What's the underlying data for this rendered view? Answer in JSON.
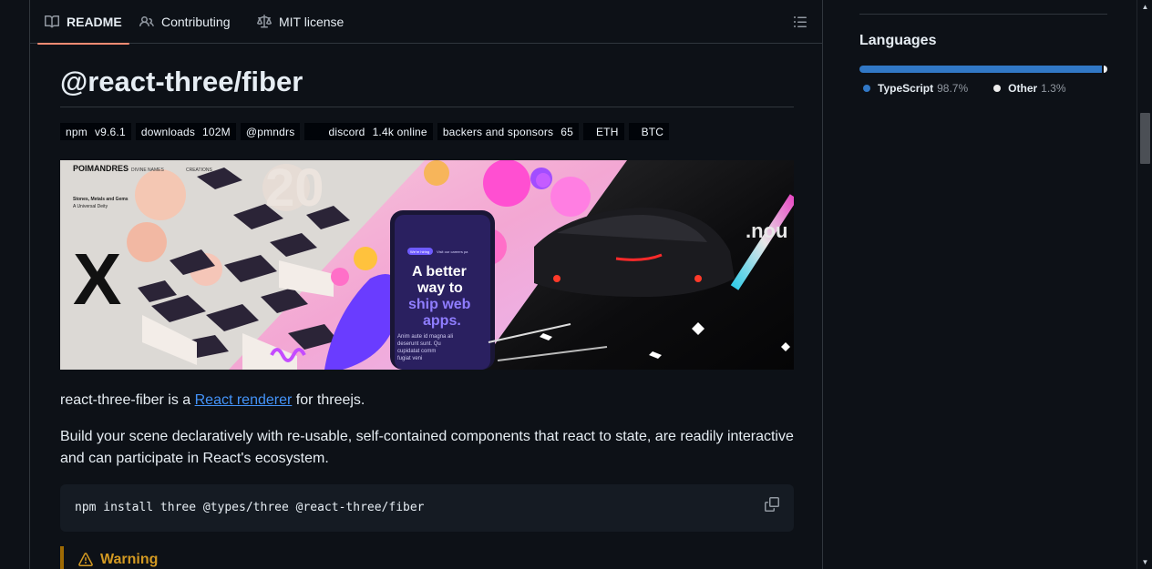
{
  "tabs": [
    {
      "label": "README",
      "icon": "book-icon",
      "active": true
    },
    {
      "label": "Contributing",
      "icon": "people-icon",
      "active": false
    },
    {
      "label": "MIT license",
      "icon": "law-icon",
      "active": false
    }
  ],
  "readme": {
    "title": "@react-three/fiber",
    "badges": [
      {
        "label": "npm",
        "value": "v9.6.1"
      },
      {
        "label": "downloads",
        "value": "102M"
      },
      {
        "label": "@pmndrs",
        "value": ""
      },
      {
        "label": "discord",
        "value": "1.4k online"
      },
      {
        "label": "backers and sponsors",
        "value": "65"
      },
      {
        "label": "ETH",
        "value": ""
      },
      {
        "label": "BTC",
        "value": ""
      }
    ],
    "hero": {
      "brand": "POIMANDRES",
      "nav1": "DIVINE NAMES",
      "nav2": "CREATIONS",
      "sub1": "Stones, Metals and Gems",
      "sub2": "A Universal Deity",
      "phone_l1": "A better",
      "phone_l2": "way to",
      "phone_l3": "ship web",
      "phone_l4": "apps.",
      "phone_body1": "Anim aute id magna ali",
      "phone_body2": "deserunt sunt. Qu",
      "phone_body3": "cupidatat comm",
      "phone_body4": "fugiat veni",
      "phone_pill1": "We're hiring",
      "phone_pill2": "Visit our careers pa",
      "corner": ".nou"
    },
    "p1_before": "react-three-fiber is a ",
    "p1_link": "React renderer",
    "p1_after": " for threejs.",
    "p2": "Build your scene declaratively with re-usable, self-contained components that react to state, are readily interactive and can participate in React's ecosystem.",
    "code": "npm install three @types/three @react-three/fiber",
    "warning": "Warning"
  },
  "sidebar": {
    "languages_heading": "Languages",
    "languages": [
      {
        "name": "TypeScript",
        "percent": "98.7%",
        "color": "#3178c6",
        "share": 98.7
      },
      {
        "name": "Other",
        "percent": "1.3%",
        "color": "#ededed",
        "share": 1.3
      }
    ]
  },
  "colors": {
    "bg": "#0d1117",
    "border": "#30363d",
    "link": "#4493f8",
    "accent_tab": "#fd8c73",
    "warning": "#d29922"
  }
}
